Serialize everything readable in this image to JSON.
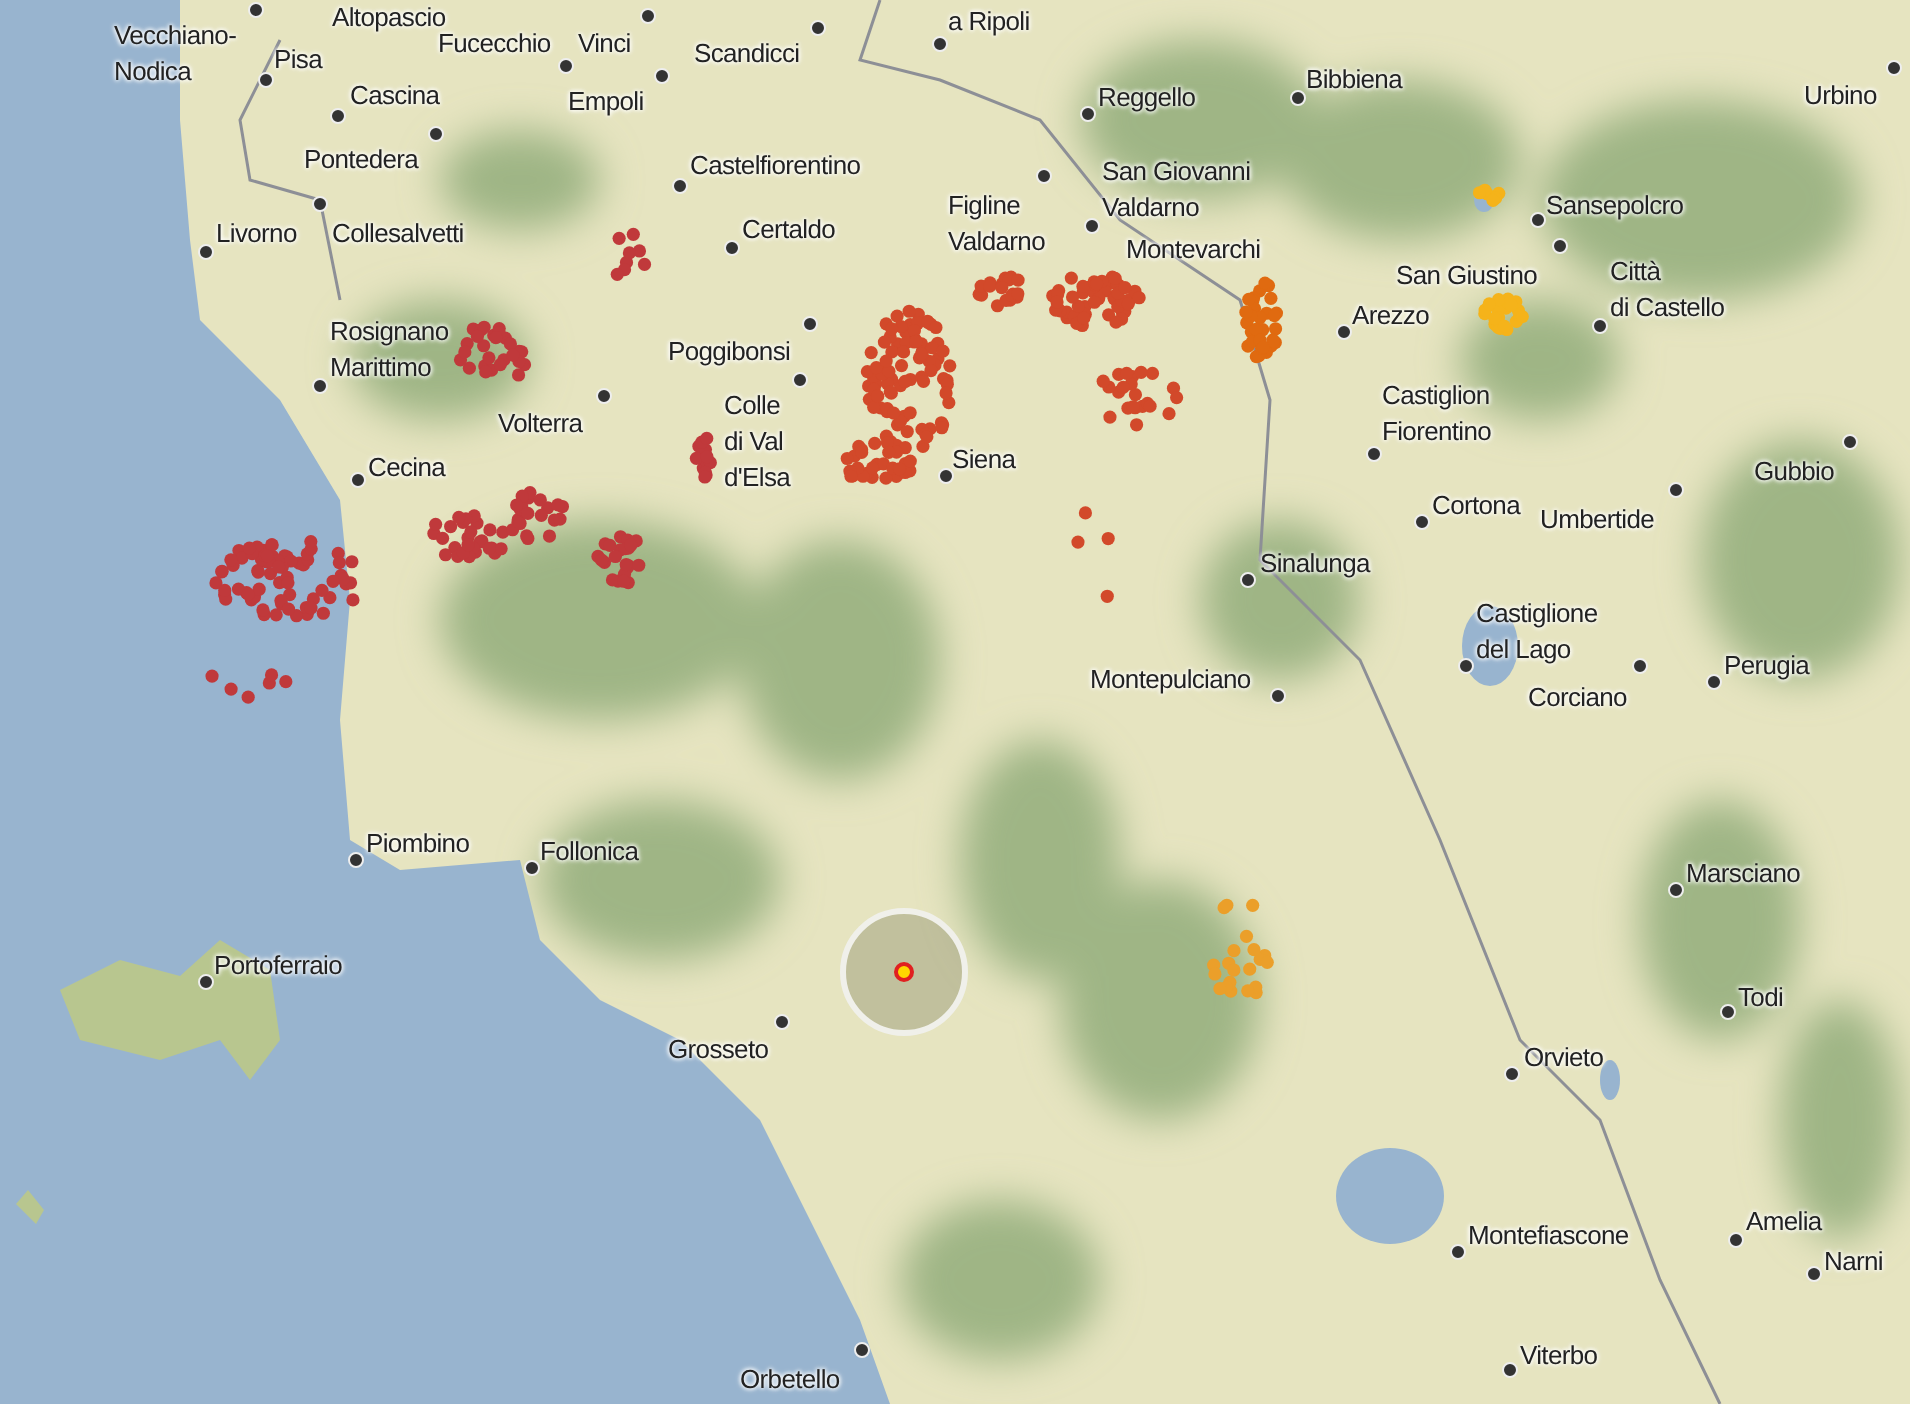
{
  "cities": [
    {
      "name": "Altopascio"
    },
    {
      "name": "Vecchiano-\nNodica"
    },
    {
      "name": "Pisa"
    },
    {
      "name": "Fucecchio"
    },
    {
      "name": "Vinci"
    },
    {
      "name": "Scandicci"
    },
    {
      "name": "a Ripoli"
    },
    {
      "name": "Cascina"
    },
    {
      "name": "Empoli"
    },
    {
      "name": "Pontedera"
    },
    {
      "name": "Castelfiorentino"
    },
    {
      "name": "Livorno"
    },
    {
      "name": "Collesalvetti"
    },
    {
      "name": "Certaldo"
    },
    {
      "name": "Rosignano\nMarittimo"
    },
    {
      "name": "Poggibonsi"
    },
    {
      "name": "Volterra"
    },
    {
      "name": "Cecina"
    },
    {
      "name": "Colle\ndi Val\nd'Elsa"
    },
    {
      "name": "Figline\nValdarno"
    },
    {
      "name": "Reggello"
    },
    {
      "name": "San Giovanni\nValdarno"
    },
    {
      "name": "Montevarchi"
    },
    {
      "name": "Siena"
    },
    {
      "name": "Bibbiena"
    },
    {
      "name": "Sansepolcro"
    },
    {
      "name": "San Giustino"
    },
    {
      "name": "Città\ndi Castello"
    },
    {
      "name": "Arezzo"
    },
    {
      "name": "Urbino"
    },
    {
      "name": "Castiglion\nFiorentino"
    },
    {
      "name": "Cortona"
    },
    {
      "name": "Umbertide"
    },
    {
      "name": "Gubbio"
    },
    {
      "name": "Sinalunga"
    },
    {
      "name": "Castiglione\ndel Lago"
    },
    {
      "name": "Perugia"
    },
    {
      "name": "Corciano"
    },
    {
      "name": "Montepulciano"
    },
    {
      "name": "Piombino"
    },
    {
      "name": "Follonica"
    },
    {
      "name": "Marsciano"
    },
    {
      "name": "Portoferraio"
    },
    {
      "name": "Todi"
    },
    {
      "name": "Grosseto"
    },
    {
      "name": "Orvieto"
    },
    {
      "name": "Amelia"
    },
    {
      "name": "Narni"
    },
    {
      "name": "Montefiascone"
    },
    {
      "name": "Viterbo"
    },
    {
      "name": "Orbetello"
    }
  ],
  "event_clusters": [
    {
      "color": "#c0393b"
    },
    {
      "color": "#d2492a"
    },
    {
      "color": "#e06a10"
    },
    {
      "color": "#f5b31a"
    },
    {
      "color": "#eb9f2a"
    }
  ]
}
